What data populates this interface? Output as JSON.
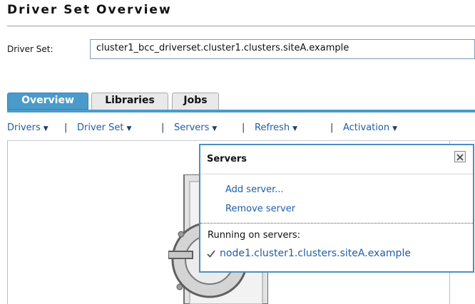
{
  "page": {
    "title": "Driver Set Overview"
  },
  "driver_set": {
    "label": "Driver Set:",
    "value": "cluster1_bcc_driverset.cluster1.clusters.siteA.example"
  },
  "tabs": [
    {
      "label": "Overview",
      "active": true
    },
    {
      "label": "Libraries",
      "active": false
    },
    {
      "label": "Jobs",
      "active": false
    }
  ],
  "menu": {
    "separator": "|",
    "items": [
      {
        "label": "Drivers"
      },
      {
        "label": "Driver Set"
      },
      {
        "label": "Servers"
      },
      {
        "label": "Refresh"
      },
      {
        "label": "Activation"
      }
    ]
  },
  "servers_popup": {
    "title": "Servers",
    "actions": [
      {
        "label": "Add server..."
      },
      {
        "label": "Remove server"
      }
    ],
    "running_label": "Running on servers:",
    "servers": [
      {
        "name": "node1.cluster1.clusters.siteA.example",
        "checked": true
      }
    ]
  },
  "colors": {
    "accent": "#4a9bcb",
    "link": "#1e5ea8",
    "popup_border": "#4a8fc4"
  },
  "icons": [
    "chevron-down-icon",
    "close-icon",
    "check-icon",
    "server-icon"
  ]
}
